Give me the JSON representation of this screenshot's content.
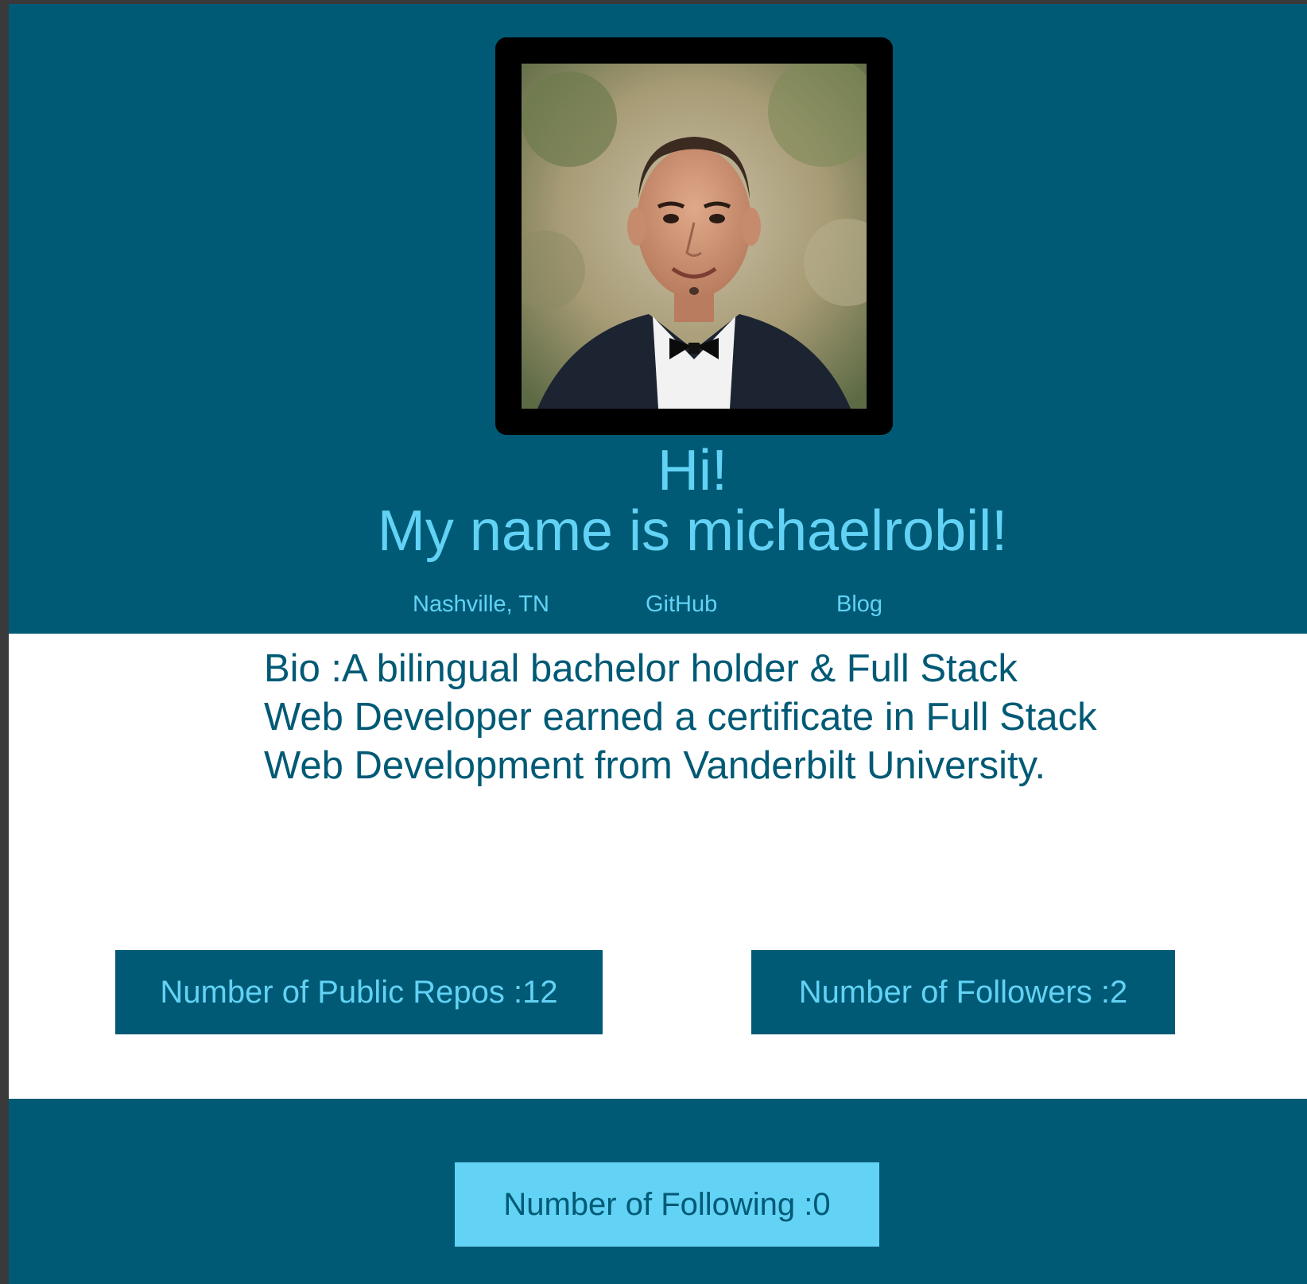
{
  "header": {
    "greeting": "Hi!",
    "name_line": "My name is michaelrobil!",
    "links": {
      "location": "Nashville, TN",
      "github": "GitHub",
      "blog": "Blog"
    }
  },
  "bio": {
    "text": "Bio :A bilingual bachelor holder & Full Stack Web Developer earned a certificate in Full Stack Web Development from Vanderbilt University."
  },
  "stats": {
    "public_repos": "Number of Public Repos :12",
    "followers": "Number of Followers :2",
    "following": "Number of Following :0"
  },
  "colors": {
    "primary": "#005a75",
    "accent": "#62d2f5",
    "background": "#ffffff"
  }
}
